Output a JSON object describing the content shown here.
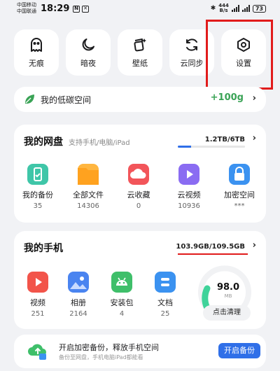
{
  "status_bar": {
    "carrier_1": "中国移动",
    "carrier_2": "中国联通",
    "time": "18:29",
    "net_speed_value": "444",
    "net_speed_unit": "B/s",
    "battery": "73"
  },
  "quick_actions": [
    {
      "label": "无痕",
      "icon": "ghost-icon"
    },
    {
      "label": "暗夜",
      "icon": "moon-icon"
    },
    {
      "label": "壁纸",
      "icon": "wallpaper-icon"
    },
    {
      "label": "云同步",
      "icon": "sync-icon"
    },
    {
      "label": "设置",
      "icon": "settings-hex-icon"
    }
  ],
  "low_carbon": {
    "label": "我的低碳空间",
    "value": "+100g",
    "icon": "leaf-icon"
  },
  "cloud_disk": {
    "title": "我的网盘",
    "subtitle": "支持手机/电脑/iPad",
    "usage": "1.2TB/6TB",
    "usage_fraction": 0.2,
    "items": [
      {
        "label": "我的备份",
        "value": "35",
        "icon": "backup-icon",
        "color": "#3fc6a8"
      },
      {
        "label": "全部文件",
        "value": "14306",
        "icon": "folder-icon",
        "color": "#ffb640"
      },
      {
        "label": "云收藏",
        "value": "0",
        "icon": "cloud-favorite-icon",
        "color": "#f2555a"
      },
      {
        "label": "云视频",
        "value": "10936",
        "icon": "video-play-icon",
        "color": "#8a6cf2"
      },
      {
        "label": "加密空间",
        "value": "***",
        "icon": "lock-icon",
        "color": "#3b92f0"
      }
    ]
  },
  "my_phone": {
    "title": "我的手机",
    "usage": "103.9GB/109.5GB",
    "items": [
      {
        "label": "视频",
        "value": "251",
        "icon": "video-icon",
        "color": "#f2544a"
      },
      {
        "label": "相册",
        "value": "2164",
        "icon": "photo-icon",
        "color": "#4a84f0"
      },
      {
        "label": "安装包",
        "value": "4",
        "icon": "android-icon",
        "color": "#3fbf6a"
      },
      {
        "label": "文档",
        "value": "25",
        "icon": "document-icon",
        "color": "#3b92f0"
      }
    ],
    "clean_value": "98.0",
    "clean_unit": "MB",
    "clean_button": "点击清理"
  },
  "backup_banner": {
    "title": "开启加密备份，释放手机空间",
    "subtitle": "备份至网盘，手机电脑iPad都能看",
    "button": "开启备份"
  },
  "colors": {
    "accent": "#2f6fe8",
    "green": "#3aa356",
    "highlight": "#e11b1b"
  }
}
